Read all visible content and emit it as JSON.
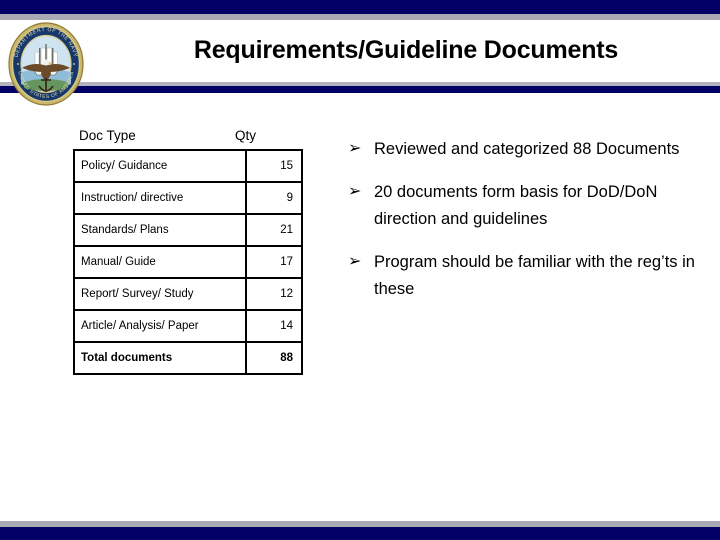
{
  "slide": {
    "title": "Requirements/Guideline Documents"
  },
  "decor": {
    "navy": "#000066",
    "gray": "#aaaab4",
    "top_band_name": "top-navy-band",
    "bottom_band_name": "bottom-navy-band"
  },
  "seal": {
    "name": "department-of-the-navy-seal",
    "ring_text_top": "DEPARTMENT OF THE NAVY",
    "ring_text_bottom": "UNITED STATES OF AMERICA",
    "gold": "#b8a24a",
    "navy": "#123a6b",
    "sky": "#bcd9ea"
  },
  "table": {
    "columns": [
      "Doc Type",
      "Qty"
    ],
    "rows": [
      {
        "type": "Policy/ Guidance",
        "qty": "15"
      },
      {
        "type": "Instruction/ directive",
        "qty": "9"
      },
      {
        "type": "Standards/ Plans",
        "qty": "21"
      },
      {
        "type": "Manual/ Guide",
        "qty": "17"
      },
      {
        "type": "Report/ Survey/ Study",
        "qty": "12"
      },
      {
        "type": "Article/ Analysis/ Paper",
        "qty": "14"
      }
    ],
    "total": {
      "type": "Total documents",
      "qty": "88"
    }
  },
  "bullets": {
    "marker": "➢",
    "items": [
      {
        "text": "Reviewed and categorized 88 Documents"
      },
      {
        "text": "20 documents form basis for DoD/DoN direction and guidelines"
      },
      {
        "text": "Program should be familiar with the reg’ts in these"
      }
    ]
  }
}
